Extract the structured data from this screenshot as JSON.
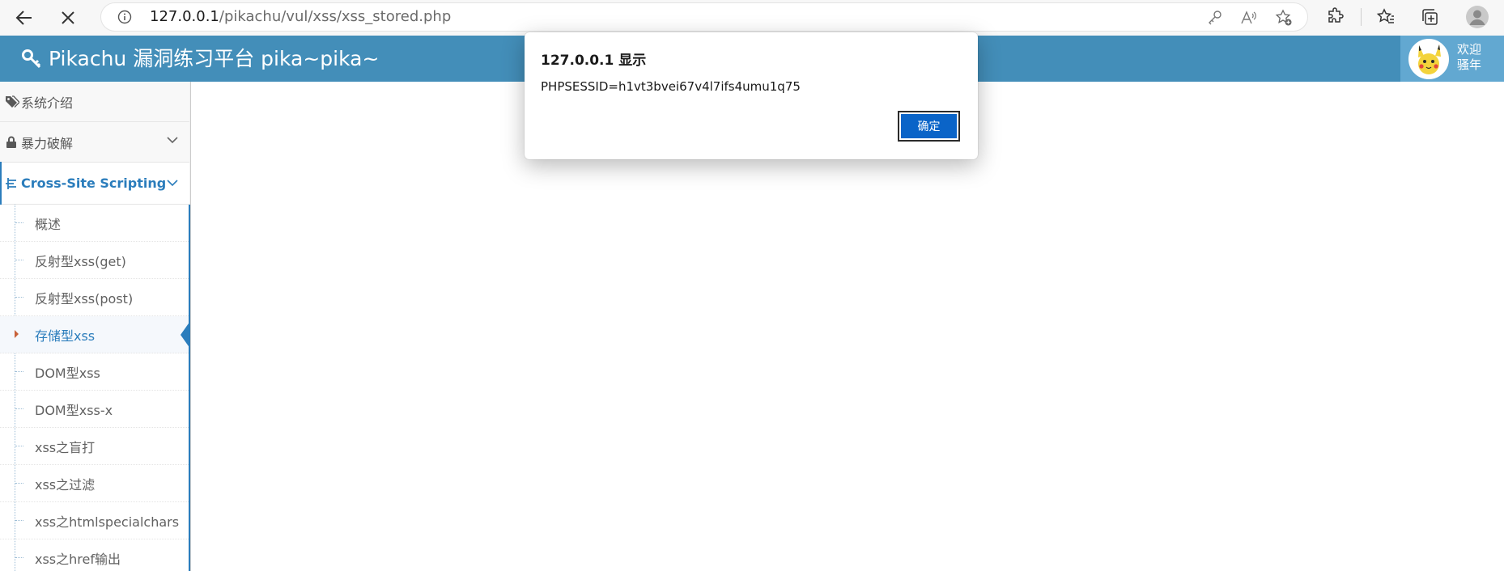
{
  "browser": {
    "url_host": "127.0.0.1",
    "url_path": "/pikachu/vul/xss/xss_stored.php"
  },
  "header": {
    "title": "Pikachu 漏洞练习平台 pika~pika~",
    "welcome_line1": "欢迎",
    "welcome_line2": "骚年"
  },
  "sidebar": {
    "items": [
      {
        "label": "系统介绍",
        "icon": "tags-icon"
      },
      {
        "label": "暴力破解",
        "icon": "lock-icon"
      },
      {
        "label": "Cross-Site Scripting",
        "icon": "sitemap-icon"
      }
    ],
    "submenu": [
      {
        "label": "概述"
      },
      {
        "label": "反射型xss(get)"
      },
      {
        "label": "反射型xss(post)"
      },
      {
        "label": "存储型xss"
      },
      {
        "label": "DOM型xss"
      },
      {
        "label": "DOM型xss-x"
      },
      {
        "label": "xss之盲打"
      },
      {
        "label": "xss之过滤"
      },
      {
        "label": "xss之htmlspecialchars"
      },
      {
        "label": "xss之href输出"
      }
    ]
  },
  "dialog": {
    "title": "127.0.0.1 显示",
    "message": "PHPSESSID=h1vt3bvei67v4l7ifs4umu1q75",
    "ok_label": "确定"
  },
  "colors": {
    "header": "#438eb9",
    "accent": "#2b7dbc",
    "dialog_button": "#0a64c8"
  }
}
